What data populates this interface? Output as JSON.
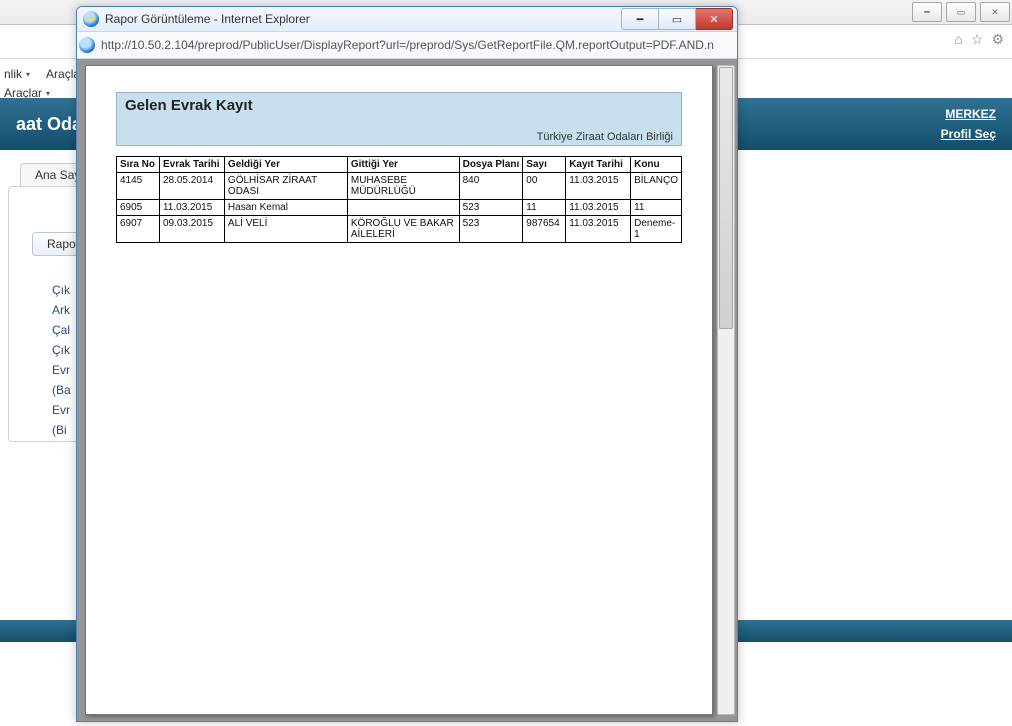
{
  "outer": {
    "menubar": {
      "item1": "nlik",
      "item2": "Araçlar"
    },
    "menubar2": {
      "item1": "Araçlar"
    },
    "bluebar_title": "aat Odala",
    "link_merkez": "MERKEZ",
    "link_profil": "Profil Seç",
    "tab_anasay": "Ana Say",
    "btn_rapor": "Rapor",
    "leftlist": [
      "Çık",
      "Ark",
      "Çal",
      "Çık",
      "Evr",
      "(Ba",
      "Evr",
      "(Bi"
    ]
  },
  "iewin": {
    "title": "Rapor Görüntüleme - Internet Explorer",
    "url": "http://10.50.2.104/preprod/PublicUser/DisplayReport?url=/preprod/Sys/GetReportFile.QM.reportOutput=PDF.AND.n"
  },
  "report": {
    "title": "Gelen Evrak Kayıt",
    "subtitle": "Türkiye Ziraat Odaları Birliği",
    "columns": [
      "Sıra No",
      "Evrak Tarihi",
      "Geldiği Yer",
      "Gittiği Yer",
      "Dosya Planı",
      "Sayı",
      "Kayıt Tarihi",
      "Konu"
    ],
    "rows": [
      {
        "sira": "4145",
        "evrak": "28.05.2014",
        "geldigi": "GÖLHİSAR ZİRAAT ODASI",
        "gittigi": "MUHASEBE MÜDÜRLÜĞÜ",
        "dosya": "840",
        "sayi": "00",
        "kayit": "11.03.2015",
        "konu": "BİLANÇO"
      },
      {
        "sira": "6905",
        "evrak": "11.03.2015",
        "geldigi": "Hasan Kemal",
        "gittigi": "",
        "dosya": "523",
        "sayi": "11",
        "kayit": "11.03.2015",
        "konu": "11"
      },
      {
        "sira": "6907",
        "evrak": "09.03.2015",
        "geldigi": "ALİ VELİ",
        "gittigi": "KÖROĞLU VE BAKAR AİLELERİ",
        "dosya": "523",
        "sayi": "987654",
        "kayit": "11.03.2015",
        "konu": "Deneme-1"
      }
    ]
  }
}
